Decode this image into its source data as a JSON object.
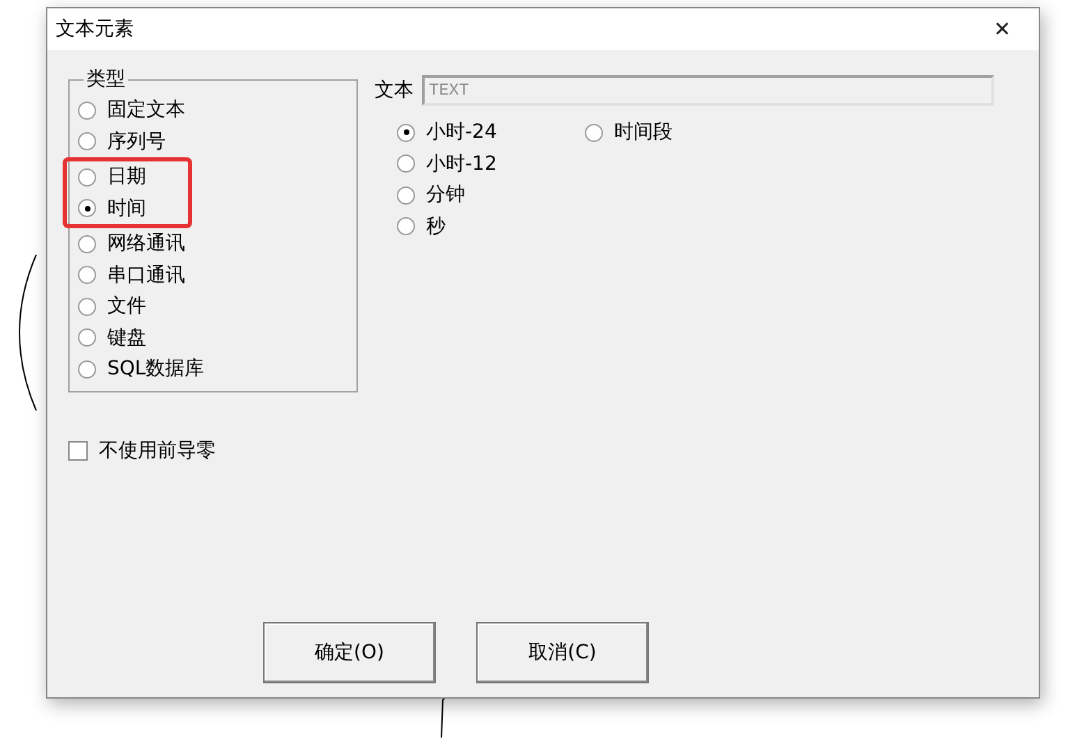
{
  "window": {
    "title": "文本元素",
    "close": "✕"
  },
  "type_group": {
    "title": "类型",
    "options": [
      {
        "label": "固定文本",
        "selected": false,
        "highlighted": false
      },
      {
        "label": "序列号",
        "selected": false,
        "highlighted": false
      },
      {
        "label": "日期",
        "selected": false,
        "highlighted": true
      },
      {
        "label": "时间",
        "selected": true,
        "highlighted": true
      },
      {
        "label": "网络通讯",
        "selected": false,
        "highlighted": false
      },
      {
        "label": "串口通讯",
        "selected": false,
        "highlighted": false
      },
      {
        "label": "文件",
        "selected": false,
        "highlighted": false
      },
      {
        "label": "键盘",
        "selected": false,
        "highlighted": false
      },
      {
        "label": "SQL数据库",
        "selected": false,
        "highlighted": false
      }
    ]
  },
  "text_field": {
    "label": "文本",
    "value": "TEXT",
    "disabled": true
  },
  "format_columns": [
    [
      {
        "label": "小时-24",
        "selected": true
      },
      {
        "label": "小时-12",
        "selected": false
      },
      {
        "label": "分钟",
        "selected": false
      },
      {
        "label": "秒",
        "selected": false
      }
    ],
    [
      {
        "label": "时间段",
        "selected": false
      }
    ]
  ],
  "no_leading_zero": {
    "label": "不使用前导零",
    "checked": false
  },
  "buttons": [
    "确定(O)",
    "取消(C)"
  ]
}
